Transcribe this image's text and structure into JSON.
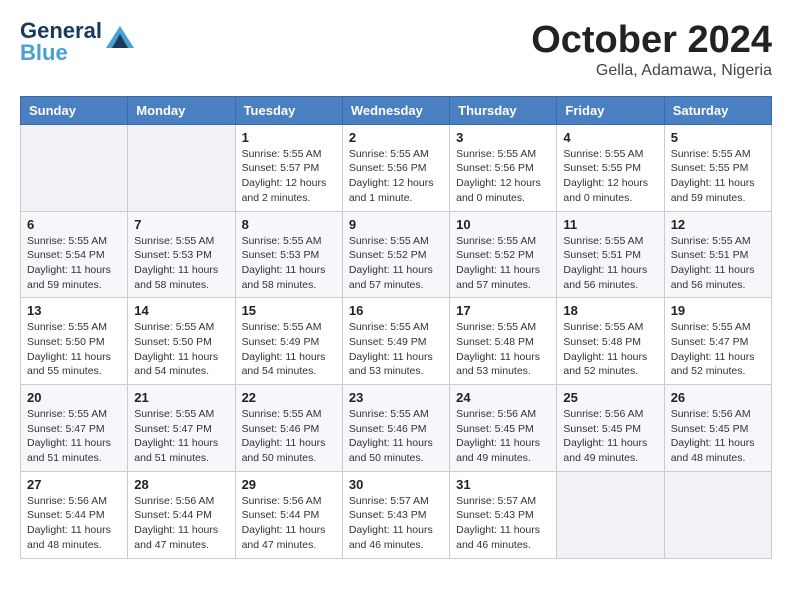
{
  "logo": {
    "line1": "General",
    "line2": "Blue"
  },
  "title": "October 2024",
  "location": "Gella, Adamawa, Nigeria",
  "headers": [
    "Sunday",
    "Monday",
    "Tuesday",
    "Wednesday",
    "Thursday",
    "Friday",
    "Saturday"
  ],
  "weeks": [
    [
      {
        "day": "",
        "info": ""
      },
      {
        "day": "",
        "info": ""
      },
      {
        "day": "1",
        "info": "Sunrise: 5:55 AM\nSunset: 5:57 PM\nDaylight: 12 hours\nand 2 minutes."
      },
      {
        "day": "2",
        "info": "Sunrise: 5:55 AM\nSunset: 5:56 PM\nDaylight: 12 hours\nand 1 minute."
      },
      {
        "day": "3",
        "info": "Sunrise: 5:55 AM\nSunset: 5:56 PM\nDaylight: 12 hours\nand 0 minutes."
      },
      {
        "day": "4",
        "info": "Sunrise: 5:55 AM\nSunset: 5:55 PM\nDaylight: 12 hours\nand 0 minutes."
      },
      {
        "day": "5",
        "info": "Sunrise: 5:55 AM\nSunset: 5:55 PM\nDaylight: 11 hours\nand 59 minutes."
      }
    ],
    [
      {
        "day": "6",
        "info": "Sunrise: 5:55 AM\nSunset: 5:54 PM\nDaylight: 11 hours\nand 59 minutes."
      },
      {
        "day": "7",
        "info": "Sunrise: 5:55 AM\nSunset: 5:53 PM\nDaylight: 11 hours\nand 58 minutes."
      },
      {
        "day": "8",
        "info": "Sunrise: 5:55 AM\nSunset: 5:53 PM\nDaylight: 11 hours\nand 58 minutes."
      },
      {
        "day": "9",
        "info": "Sunrise: 5:55 AM\nSunset: 5:52 PM\nDaylight: 11 hours\nand 57 minutes."
      },
      {
        "day": "10",
        "info": "Sunrise: 5:55 AM\nSunset: 5:52 PM\nDaylight: 11 hours\nand 57 minutes."
      },
      {
        "day": "11",
        "info": "Sunrise: 5:55 AM\nSunset: 5:51 PM\nDaylight: 11 hours\nand 56 minutes."
      },
      {
        "day": "12",
        "info": "Sunrise: 5:55 AM\nSunset: 5:51 PM\nDaylight: 11 hours\nand 56 minutes."
      }
    ],
    [
      {
        "day": "13",
        "info": "Sunrise: 5:55 AM\nSunset: 5:50 PM\nDaylight: 11 hours\nand 55 minutes."
      },
      {
        "day": "14",
        "info": "Sunrise: 5:55 AM\nSunset: 5:50 PM\nDaylight: 11 hours\nand 54 minutes."
      },
      {
        "day": "15",
        "info": "Sunrise: 5:55 AM\nSunset: 5:49 PM\nDaylight: 11 hours\nand 54 minutes."
      },
      {
        "day": "16",
        "info": "Sunrise: 5:55 AM\nSunset: 5:49 PM\nDaylight: 11 hours\nand 53 minutes."
      },
      {
        "day": "17",
        "info": "Sunrise: 5:55 AM\nSunset: 5:48 PM\nDaylight: 11 hours\nand 53 minutes."
      },
      {
        "day": "18",
        "info": "Sunrise: 5:55 AM\nSunset: 5:48 PM\nDaylight: 11 hours\nand 52 minutes."
      },
      {
        "day": "19",
        "info": "Sunrise: 5:55 AM\nSunset: 5:47 PM\nDaylight: 11 hours\nand 52 minutes."
      }
    ],
    [
      {
        "day": "20",
        "info": "Sunrise: 5:55 AM\nSunset: 5:47 PM\nDaylight: 11 hours\nand 51 minutes."
      },
      {
        "day": "21",
        "info": "Sunrise: 5:55 AM\nSunset: 5:47 PM\nDaylight: 11 hours\nand 51 minutes."
      },
      {
        "day": "22",
        "info": "Sunrise: 5:55 AM\nSunset: 5:46 PM\nDaylight: 11 hours\nand 50 minutes."
      },
      {
        "day": "23",
        "info": "Sunrise: 5:55 AM\nSunset: 5:46 PM\nDaylight: 11 hours\nand 50 minutes."
      },
      {
        "day": "24",
        "info": "Sunrise: 5:56 AM\nSunset: 5:45 PM\nDaylight: 11 hours\nand 49 minutes."
      },
      {
        "day": "25",
        "info": "Sunrise: 5:56 AM\nSunset: 5:45 PM\nDaylight: 11 hours\nand 49 minutes."
      },
      {
        "day": "26",
        "info": "Sunrise: 5:56 AM\nSunset: 5:45 PM\nDaylight: 11 hours\nand 48 minutes."
      }
    ],
    [
      {
        "day": "27",
        "info": "Sunrise: 5:56 AM\nSunset: 5:44 PM\nDaylight: 11 hours\nand 48 minutes."
      },
      {
        "day": "28",
        "info": "Sunrise: 5:56 AM\nSunset: 5:44 PM\nDaylight: 11 hours\nand 47 minutes."
      },
      {
        "day": "29",
        "info": "Sunrise: 5:56 AM\nSunset: 5:44 PM\nDaylight: 11 hours\nand 47 minutes."
      },
      {
        "day": "30",
        "info": "Sunrise: 5:57 AM\nSunset: 5:43 PM\nDaylight: 11 hours\nand 46 minutes."
      },
      {
        "day": "31",
        "info": "Sunrise: 5:57 AM\nSunset: 5:43 PM\nDaylight: 11 hours\nand 46 minutes."
      },
      {
        "day": "",
        "info": ""
      },
      {
        "day": "",
        "info": ""
      }
    ]
  ]
}
